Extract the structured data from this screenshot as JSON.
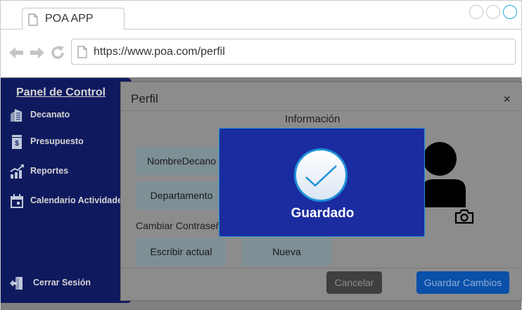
{
  "browser": {
    "tab_title": "POA APP",
    "url": "https://www.poa.com/perfil"
  },
  "sidebar": {
    "title": "Panel de Control",
    "items": [
      {
        "label": "Decanato",
        "icon": "building-icon"
      },
      {
        "label": "Presupuesto",
        "icon": "budget-icon"
      },
      {
        "label": "Reportes",
        "icon": "chart-icon"
      },
      {
        "label": "Calendario Actividades",
        "icon": "calendar-icon"
      }
    ],
    "logout_label": "Cerrar Sesión"
  },
  "modal": {
    "title": "Perfil",
    "close": "×",
    "section_title": "Información",
    "fields": {
      "dean_name": "NombreDecano",
      "department": "Departamento"
    },
    "password_section": "Cambiar Contraseña",
    "password_current": "Escribir actual",
    "password_new": "Nueva",
    "cancel_label": "Cancelar",
    "save_label": "Guardar Cambios"
  },
  "alert": {
    "message": "Guardado"
  },
  "colors": {
    "sidebar_bg": "#0f1a5e",
    "alert_bg": "#1a2ca0",
    "accent": "#1e90d8"
  }
}
